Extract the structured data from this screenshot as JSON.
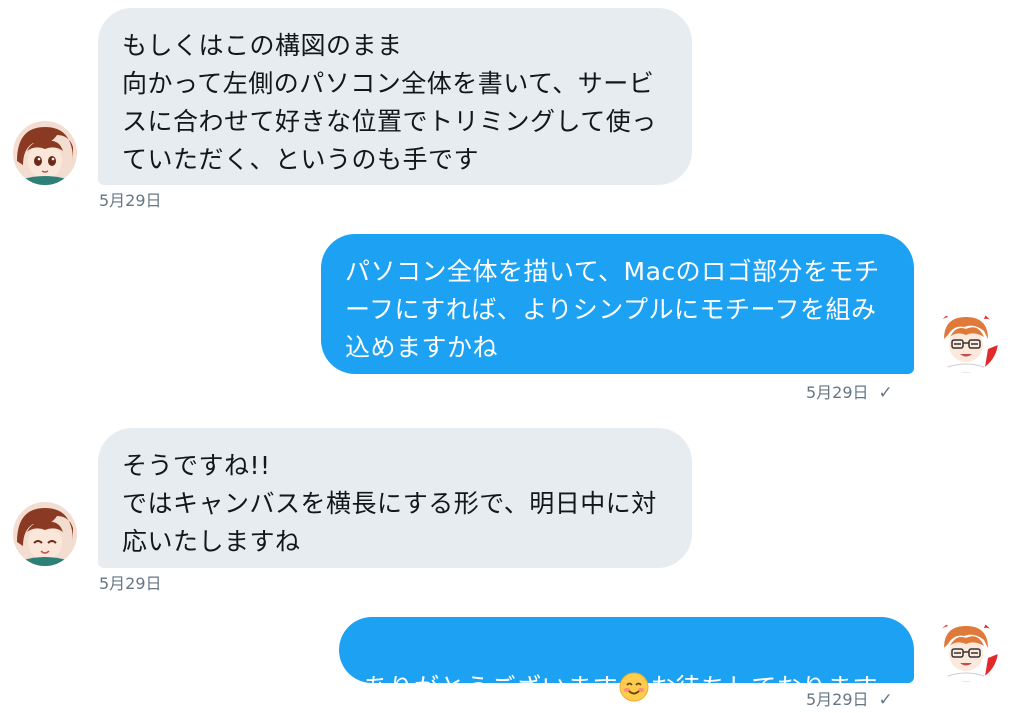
{
  "messages": [
    {
      "direction": "received",
      "text": "もしくはこの構図のまま\n向かって左側のパソコン全体を書いて、サービ\nスに合わせて好きな位置でトリミングして使っ\nていただく、というのも手です",
      "timestamp": "5月29日"
    },
    {
      "direction": "sent",
      "text": "パソコン全体を描いて、Macのロゴ部分をモチ\nーフにすれば、よりシンプルにモチーフを組み\n込めますかね",
      "timestamp": "5月29日",
      "status_icon": "✓"
    },
    {
      "direction": "received",
      "text": "そうですね!!\nではキャンバスを横長にする形で、明日中に対\n応いたしますね",
      "timestamp": "5月29日"
    },
    {
      "direction": "sent",
      "text_before_emoji": "ありがとうございます",
      "emoji": "smiling-face-emoji",
      "text_after_emoji": "お待ちしております",
      "timestamp": "5月29日",
      "status_icon": "✓"
    }
  ],
  "colors": {
    "received_bubble": "#e6ecf0",
    "sent_bubble": "#1da1f2",
    "timestamp": "#657786"
  }
}
